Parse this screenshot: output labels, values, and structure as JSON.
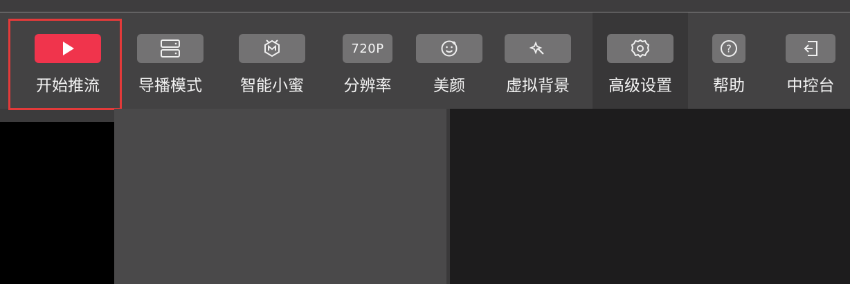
{
  "toolbar": {
    "items": [
      {
        "id": "start-stream",
        "label": "开始推流",
        "icon": "play-icon",
        "active": true,
        "color": "#f0344c"
      },
      {
        "id": "director-mode",
        "label": "导播模式",
        "icon": "server-stack-icon"
      },
      {
        "id": "smart-assistant",
        "label": "智能小蜜",
        "icon": "assistant-face-icon"
      },
      {
        "id": "resolution",
        "label": "分辨率",
        "icon": "resolution-text",
        "value": "720P"
      },
      {
        "id": "beauty",
        "label": "美颜",
        "icon": "smile-face-icon"
      },
      {
        "id": "virtual-background",
        "label": "虚拟背景",
        "icon": "magic-wand-icon"
      },
      {
        "id": "advanced-settings",
        "label": "高级设置",
        "icon": "gear-icon"
      },
      {
        "id": "help",
        "label": "帮助",
        "icon": "help-circle-icon"
      },
      {
        "id": "console",
        "label": "中控台",
        "icon": "enter-console-icon"
      }
    ]
  },
  "colors": {
    "highlight_frame": "#e33a3a",
    "toolbar_bg": "#434243",
    "button_bg": "#737273"
  }
}
